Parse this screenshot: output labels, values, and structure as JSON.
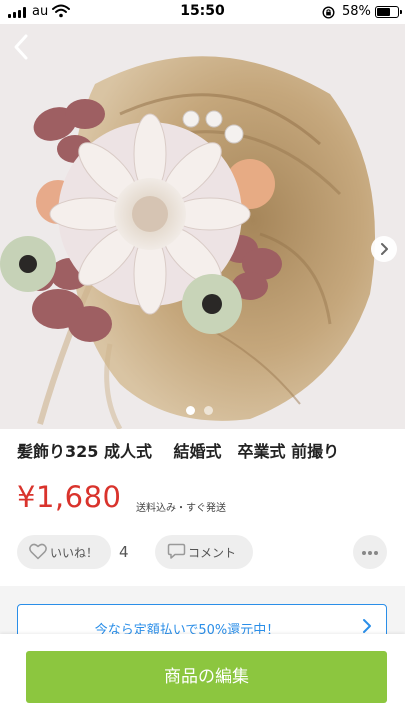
{
  "status_bar": {
    "carrier": "au",
    "time": "15:50",
    "battery_percent": "58%",
    "battery_level": 0.58,
    "icons": [
      "signal-icon",
      "wifi-icon",
      "orientation-lock-icon",
      "battery-icon"
    ]
  },
  "gallery": {
    "image_count": 2,
    "current_index": 1,
    "icons": [
      "back-chevron-icon",
      "next-chevron-icon"
    ]
  },
  "product": {
    "title": "髪飾り325 成人式　 結婚式　卒業式 前撮り",
    "price": "¥1,680",
    "shipping": "送料込み・すぐ発送"
  },
  "actions": {
    "like_label": "いいね！",
    "like_count": "4",
    "comment_label": "コメント",
    "icons": [
      "heart-icon",
      "comment-icon",
      "more-icon"
    ]
  },
  "promo": {
    "label": "今なら定額払いで50%還元中！",
    "icon": "chevron-right-icon"
  },
  "bottom": {
    "edit_label": "商品の編集"
  },
  "colors": {
    "price_red": "#d9332c",
    "promo_blue": "#2a8ee8",
    "edit_green": "#8cc63f"
  }
}
